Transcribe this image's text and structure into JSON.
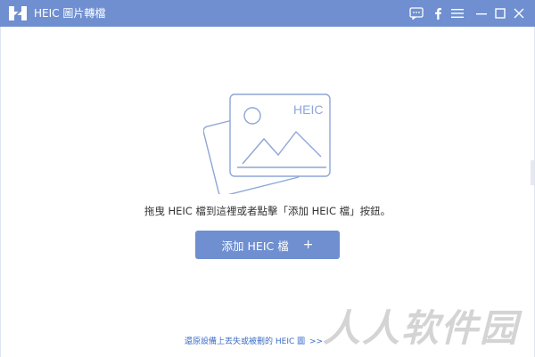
{
  "titlebar": {
    "title": "HEIC 圖片轉檔",
    "icons": [
      "chat-icon",
      "facebook-icon",
      "menu-icon",
      "minimize-icon",
      "maximize-icon",
      "close-icon"
    ]
  },
  "main": {
    "illustration_label": "HEIC",
    "hint": "拖曳 HEIC 檔到這裡或者點擊「添加 HEIC 檔」按鈕。",
    "add_button_label": "添加 HEIC 檔",
    "add_button_symbol": "+"
  },
  "footer": {
    "link_text": "還原設備上丟失或被刪的 HEIC 圖",
    "arrow": ">>"
  },
  "watermark": {
    "text": "人人软件园"
  },
  "colors": {
    "accent": "#6f8fd0",
    "link": "#3b6cc6",
    "illustration_stroke": "#8fa6d6"
  }
}
